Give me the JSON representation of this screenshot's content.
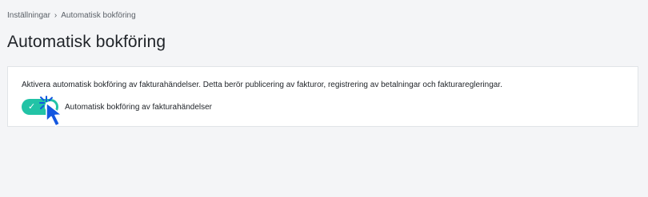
{
  "breadcrumb": {
    "items": [
      "Inställningar",
      "Automatisk bokföring"
    ],
    "separator": "›"
  },
  "page": {
    "title": "Automatisk bokföring"
  },
  "settings_card": {
    "description": "Aktivera automatisk bokföring av fakturahändelser. Detta berör publicering av fakturor, registrering av betalningar och fakturaregleringar.",
    "toggle": {
      "label": "Automatisk bokföring av fakturahändelser",
      "state": "on",
      "check_glyph": "✓",
      "color": "#22c3a6"
    }
  },
  "cursor": {
    "icon": "pointer-cursor-icon",
    "color": "#1457e0"
  }
}
